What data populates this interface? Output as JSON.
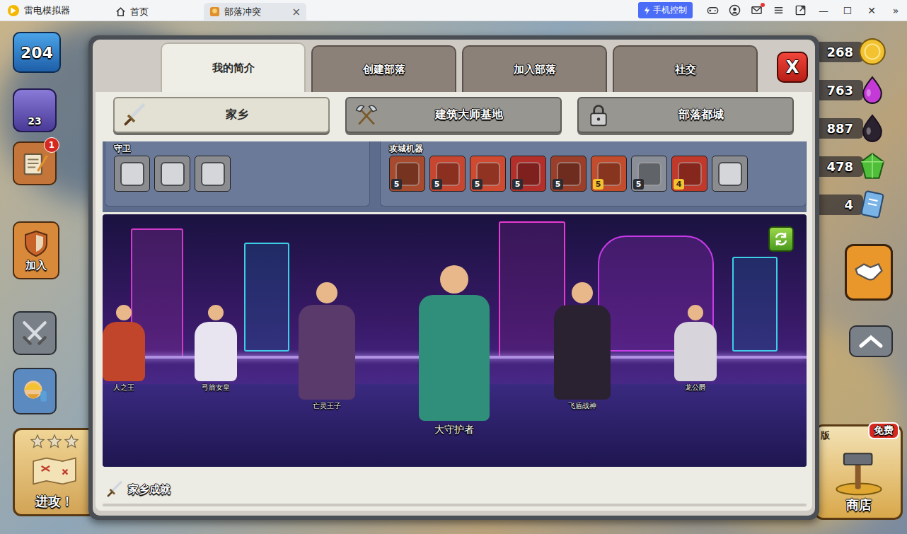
{
  "emulator": {
    "app_name": "雷电模拟器",
    "tabs": [
      {
        "label": "首页",
        "selected": false
      },
      {
        "label": "部落冲突",
        "selected": true
      }
    ],
    "tab_close": "×",
    "phone_control": "手机控制",
    "mail_unread": true,
    "window_controls": [
      "—",
      "☐",
      "✕",
      "»"
    ]
  },
  "hud_left": {
    "level": "204",
    "builder_trophies": "23",
    "quest_badge": "1",
    "clan_button": "加入",
    "attack_button": "进攻！",
    "attack_stars": 0
  },
  "resources": [
    {
      "amount": "268",
      "color": "#f2c230"
    },
    {
      "amount": "763",
      "color": "#c43ad6"
    },
    {
      "amount": "887",
      "color": "#2b2230"
    },
    {
      "amount": "478",
      "color": "#4fbf3a"
    },
    {
      "amount": "4",
      "color": "#7ab4e6"
    }
  ],
  "shop": {
    "label": "商店",
    "badge": "免费",
    "banner": "版"
  },
  "profile": {
    "tabs": [
      {
        "label": "我的简介",
        "selected": true
      },
      {
        "label": "创建部落",
        "selected": false
      },
      {
        "label": "加入部落",
        "selected": false
      },
      {
        "label": "社交",
        "selected": false
      }
    ],
    "close": "X",
    "subtabs": [
      {
        "label": "家乡",
        "selected": true,
        "locked": false
      },
      {
        "label": "建筑大师基地",
        "selected": false,
        "locked": false
      },
      {
        "label": "部落都城",
        "selected": false,
        "locked": true
      }
    ],
    "pets": {
      "title": "守卫",
      "items": [
        {
          "locked": true
        },
        {
          "locked": true
        },
        {
          "locked": true
        }
      ]
    },
    "siege": {
      "title": "攻城机器",
      "items": [
        {
          "level": "5",
          "maxed": false,
          "locked": false,
          "color": "#a84a2e"
        },
        {
          "level": "5",
          "maxed": false,
          "locked": false,
          "color": "#c8452f"
        },
        {
          "level": "5",
          "maxed": false,
          "locked": false,
          "color": "#d04a32"
        },
        {
          "level": "5",
          "maxed": false,
          "locked": false,
          "color": "#b52f2a"
        },
        {
          "level": "5",
          "maxed": false,
          "locked": false,
          "color": "#9c3f2a"
        },
        {
          "level": "5",
          "maxed": true,
          "locked": false,
          "color": "#c24c2c"
        },
        {
          "level": "5",
          "maxed": false,
          "locked": false,
          "color": "#8a8e96"
        },
        {
          "level": "4",
          "maxed": true,
          "locked": false,
          "color": "#c0392b"
        },
        {
          "locked": true,
          "color": "#7a7a7a"
        }
      ]
    },
    "heroes": [
      {
        "name": "人之王",
        "featured": false,
        "color": "#c0452a"
      },
      {
        "name": "弓箭女皇",
        "featured": false,
        "color": "#e8e4f0"
      },
      {
        "name": "亡灵王子",
        "featured": false,
        "color": "#5a3a6a"
      },
      {
        "name": "大守护者",
        "featured": true,
        "color": "#2f8f7a"
      },
      {
        "name": "飞盾战神",
        "featured": false,
        "color": "#2a2230"
      },
      {
        "name": "龙公爵",
        "featured": false,
        "color": "#d8d4dc"
      }
    ],
    "achievements": "家乡成就"
  }
}
